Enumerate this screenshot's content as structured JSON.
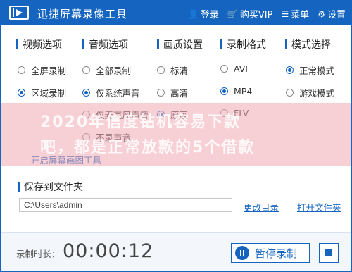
{
  "window": {
    "title": "迅捷屏幕录像工具",
    "menu": [
      {
        "icon": "user-icon",
        "label": "登录"
      },
      {
        "icon": "cart-icon",
        "label": "购买VIP"
      },
      {
        "icon": "menu-icon",
        "label": "菜单"
      },
      {
        "icon": "gear-icon",
        "label": "设置"
      }
    ]
  },
  "options": {
    "video": {
      "title": "视频选项",
      "items": [
        {
          "label": "全屏录制",
          "selected": false
        },
        {
          "label": "区域录制",
          "selected": true
        }
      ]
    },
    "audio": {
      "title": "音频选项",
      "items": [
        {
          "label": "全部录制",
          "selected": false
        },
        {
          "label": "仅系统声音",
          "selected": true
        },
        {
          "label": "仅麦克风声音",
          "selected": false
        },
        {
          "label": "不录声音",
          "selected": false
        }
      ]
    },
    "quality": {
      "title": "画质设置",
      "items": [
        {
          "label": "标清",
          "selected": false
        },
        {
          "label": "高清",
          "selected": false
        },
        {
          "label": "原画",
          "selected": true
        }
      ]
    },
    "format": {
      "title": "录制格式",
      "items": [
        {
          "label": "AVI",
          "selected": false
        },
        {
          "label": "MP4",
          "selected": true
        },
        {
          "label": "FLV",
          "selected": false
        }
      ]
    },
    "mode": {
      "title": "模式选择",
      "items": [
        {
          "label": "正常模式",
          "selected": true
        },
        {
          "label": "游戏模式",
          "selected": false
        }
      ]
    }
  },
  "checkbox": {
    "label": "开启屏幕画图工具",
    "checked": false
  },
  "save": {
    "title": "保存到文件夹",
    "path": "C:\\Users\\admin",
    "change_label": "更改目录",
    "open_label": "打开文件夹"
  },
  "bottom": {
    "duration_label": "录制时长：",
    "duration_value": "00:00:12",
    "pause_label": "暂停录制"
  },
  "watermark": {
    "line1": "2020年信度钻机容易下款",
    "line2": "吧，都是正常放款的5个借款"
  },
  "colors": {
    "accent": "#1565c0"
  }
}
